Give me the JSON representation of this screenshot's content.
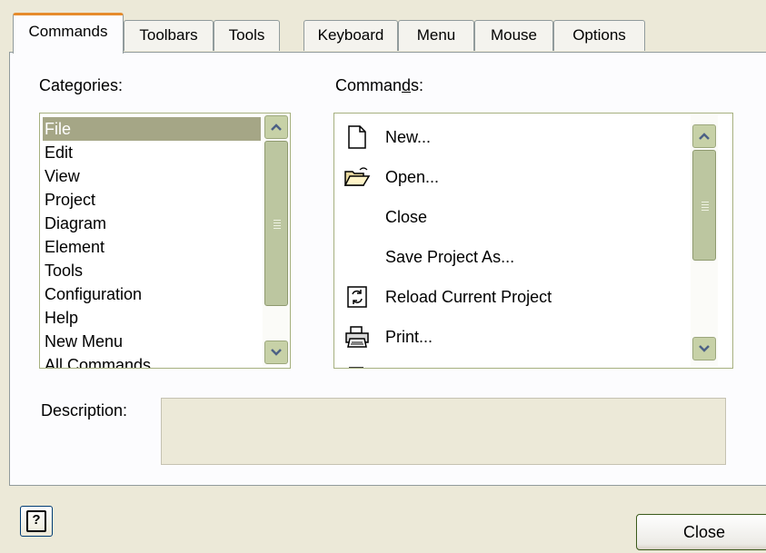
{
  "tabs": [
    "Commands",
    "Toolbars",
    "Tools",
    "Keyboard",
    "Menu",
    "Mouse",
    "Options"
  ],
  "categories_label": "Categories:",
  "commands_label": "Commands:",
  "commands_label_parts": {
    "before": "Comman",
    "mnemonic": "d",
    "after": "s:"
  },
  "categories": [
    "File",
    "Edit",
    "View",
    "Project",
    "Diagram",
    "Element",
    "Tools",
    "Configuration",
    "Help",
    "New Menu",
    "All Commands"
  ],
  "selected_category": "File",
  "commands": [
    {
      "label": "New...",
      "icon": "new-document-icon"
    },
    {
      "label": "Open...",
      "icon": "open-folder-icon"
    },
    {
      "label": "Close",
      "icon": ""
    },
    {
      "label": "Save Project As...",
      "icon": ""
    },
    {
      "label": "Reload Current Project",
      "icon": "reload-icon"
    },
    {
      "label": "Print...",
      "icon": "printer-icon"
    }
  ],
  "description_label": "Description:",
  "description_value": "",
  "help_button_label": "?",
  "close_button_label": "Close"
}
